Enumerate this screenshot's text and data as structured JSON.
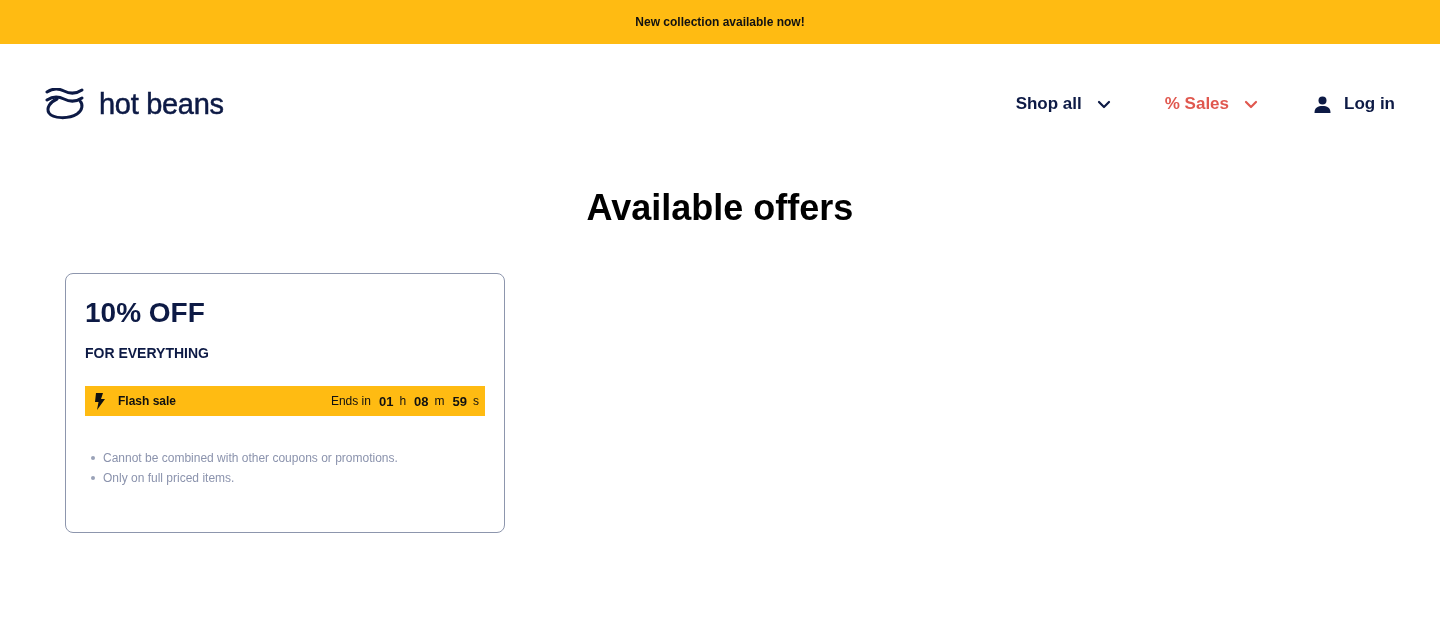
{
  "announcement": {
    "text": "New collection available now!"
  },
  "header": {
    "logo": {
      "text": "hot beans"
    },
    "nav": [
      {
        "kind": "dropdown",
        "label": "Shop all",
        "highlighted": false
      },
      {
        "kind": "dropdown",
        "label": "% Sales",
        "highlighted": true
      },
      {
        "kind": "account",
        "label": "Log in",
        "highlighted": false
      }
    ]
  },
  "page": {
    "title": "Available offers"
  },
  "offers": [
    {
      "discount": "10% OFF",
      "scope": "FOR EVERYTHING",
      "flash": {
        "label": "Flash sale",
        "countdown_label": "Ends in",
        "parts": [
          {
            "value": "01",
            "unit": "h"
          },
          {
            "value": "08",
            "unit": "m"
          },
          {
            "value": "59",
            "unit": "s"
          }
        ]
      },
      "terms": [
        "Cannot be combined with other coupons or promotions.",
        "Only on full priced items."
      ]
    }
  ]
}
